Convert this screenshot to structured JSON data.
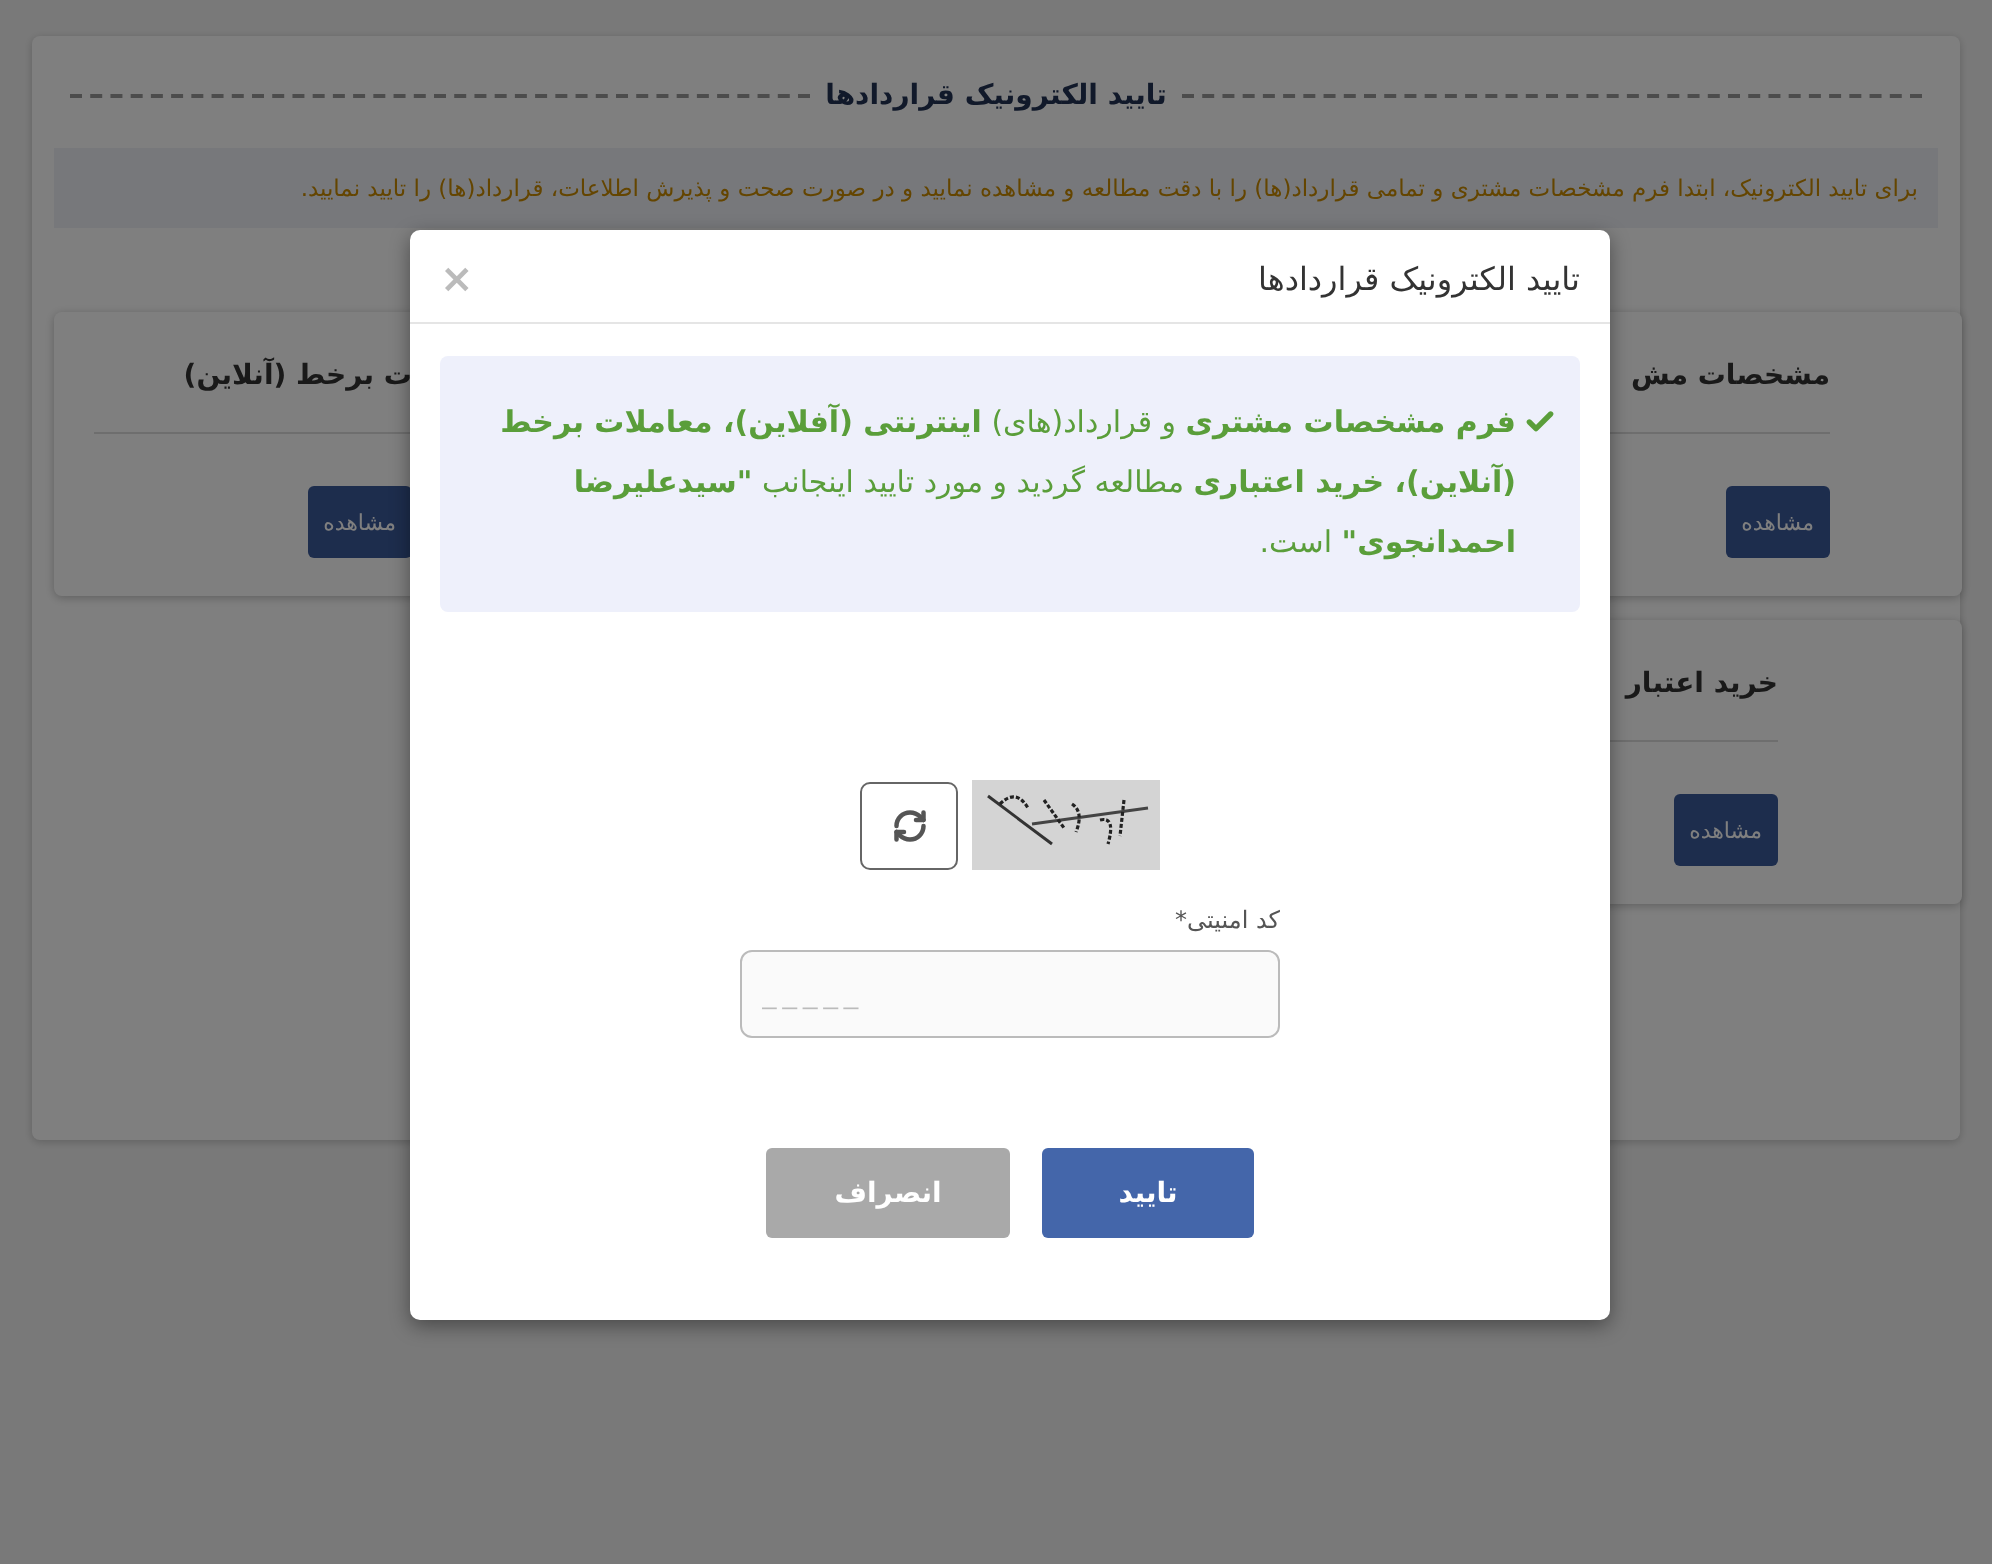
{
  "page": {
    "title": "تایید الکترونیک قراردادها",
    "notice": "برای تایید الکترونیک، ابتدا فرم مشخصات مشتری و تمامی قرارداد(ها) را با دقت مطالعه و مشاهده نمایید و در صورت صحت و پذیرش اطلاعات، قرارداد(ها) را تایید نمایید.",
    "cards": [
      {
        "title": "مشخصات مش",
        "button": "مشاهده"
      },
      {
        "title": "ت برخط (آنلاین)",
        "button": "مشاهده"
      },
      {
        "title": "خرید اعتبار",
        "button": "مشاهده"
      }
    ]
  },
  "modal": {
    "title": "تایید الکترونیک قراردادها",
    "close": "×",
    "message": "**فرم مشخصات مشتری** و قرارداد(های) **اینترنتی (آفلاین)، معاملات برخط (آنلاین)، خرید اعتباری** مطالعه گردید و مورد تایید اینجانب **\"سیدعلیرضا احمدانجوی\"** است.",
    "captcha": {
      "label": "کد امنیتی*",
      "placeholder": "_____"
    },
    "buttons": [
      {
        "label": "تایید",
        "kind": "primary"
      },
      {
        "label": "انصراف",
        "kind": "secondary"
      }
    ]
  }
}
